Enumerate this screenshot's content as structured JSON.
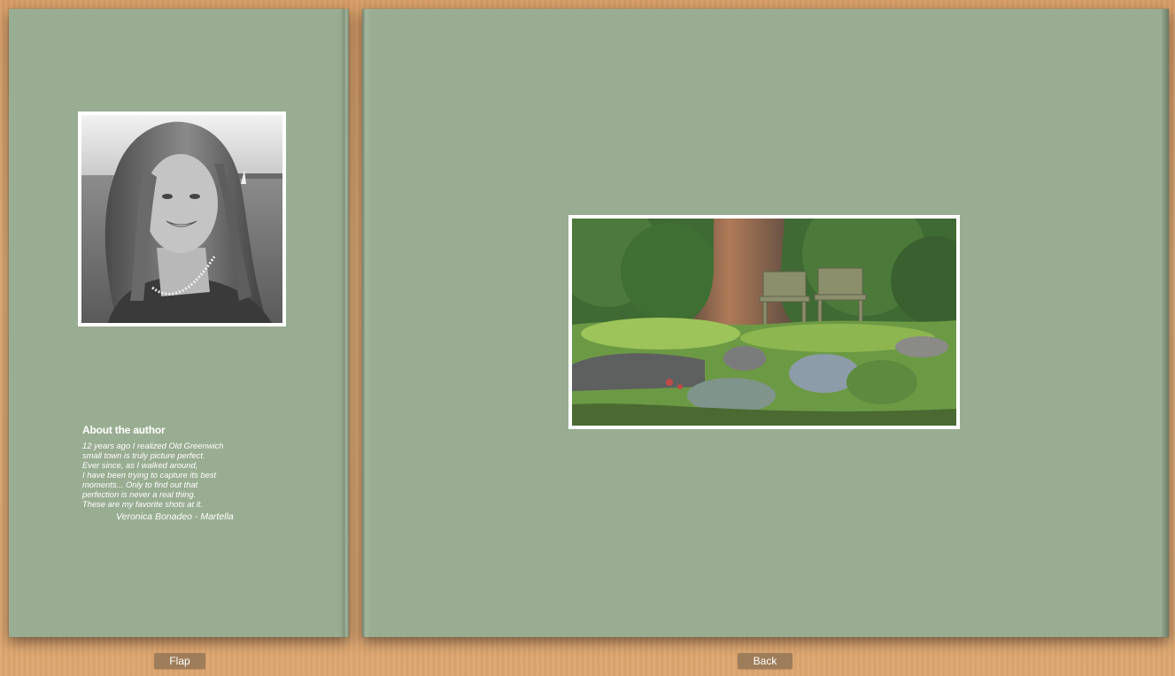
{
  "flap_panel": {
    "about_title": "About the author",
    "about_lines": [
      "12 years ago I realized Old Greenwich",
      "small town is truly picture perfect.",
      "Ever since, as I walked around,",
      "I have been trying to capture its best",
      "moments... Only to find out that",
      "perfection is never a real thing.",
      "These are my favorite shots at it."
    ],
    "signature": "Veronica Bonadeo - Martella"
  },
  "buttons": {
    "flap_label": "Flap",
    "back_label": "Back"
  },
  "colors": {
    "panel_background": "#99ad92",
    "table_wood": "#dda56f",
    "button_background": "#9e7d5a",
    "photo_border": "#ffffff"
  }
}
